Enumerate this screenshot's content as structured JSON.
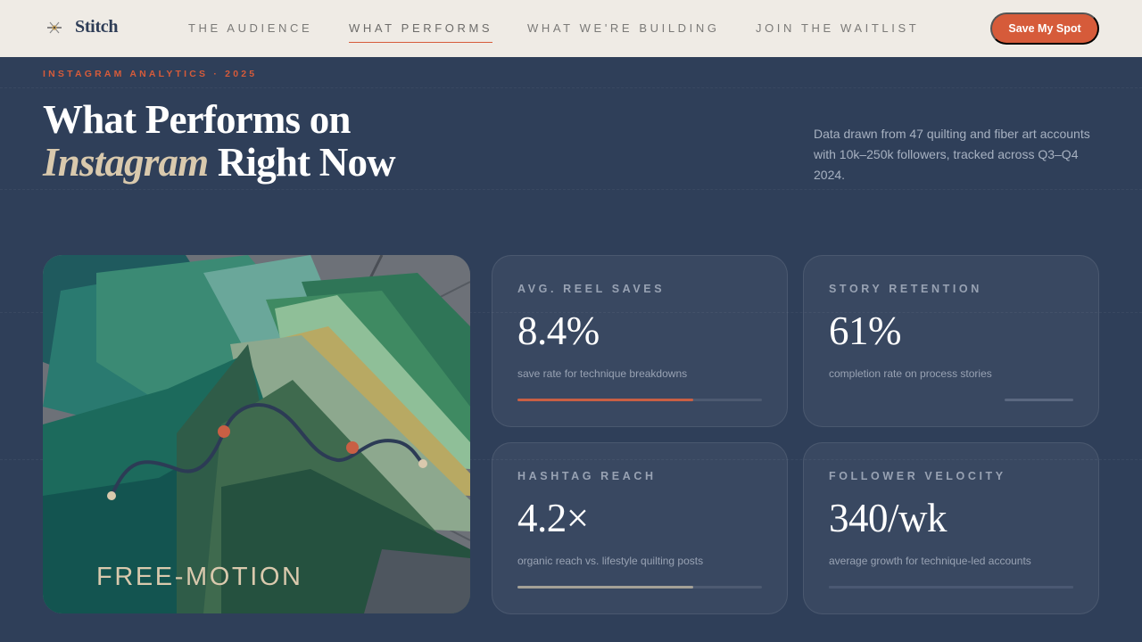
{
  "nav": {
    "brand": "Stitch",
    "links": [
      {
        "label": "THE AUDIENCE",
        "active": false
      },
      {
        "label": "WHAT PERFORMS",
        "active": true
      },
      {
        "label": "WHAT WE'RE BUILDING",
        "active": false
      },
      {
        "label": "JOIN THE WAITLIST",
        "active": false
      }
    ],
    "cta": "Save My Spot"
  },
  "hero": {
    "eyebrow": "INSTAGRAM ANALYTICS · 2025",
    "title_line1": "What Performs on",
    "title_italic": "Instagram",
    "title_rest": " Right Now",
    "description": "Data drawn from 47 quilting and fiber art accounts with 10k–250k followers, tracked across Q3–Q4 2024."
  },
  "image_card": {
    "caption": "FREE-MOTION"
  },
  "stats": [
    {
      "label": "AVG. REEL SAVES",
      "value": "8.4%",
      "sub": "save rate for technique breakdowns",
      "progress": 0.72,
      "bar_color": "#c95f44"
    },
    {
      "label": "STORY RETENTION",
      "value": "61%",
      "sub": "completion rate on process stories",
      "progress": 0.28,
      "bar_color": "#5b6880"
    },
    {
      "label": "HASHTAG REACH",
      "value": "4.2×",
      "sub": "organic reach vs. lifestyle quilting posts",
      "progress": 0.72,
      "bar_color": "#a4a197"
    },
    {
      "label": "FOLLOWER VELOCITY",
      "value": "340/wk",
      "sub": "average growth for technique-led accounts",
      "progress": 1.0,
      "bar_color": "#4a5872"
    }
  ],
  "colors": {
    "background": "#2f3f59",
    "accent": "#d65b3a",
    "cream": "#d9c9ad",
    "nav_bg": "#efebe5"
  }
}
